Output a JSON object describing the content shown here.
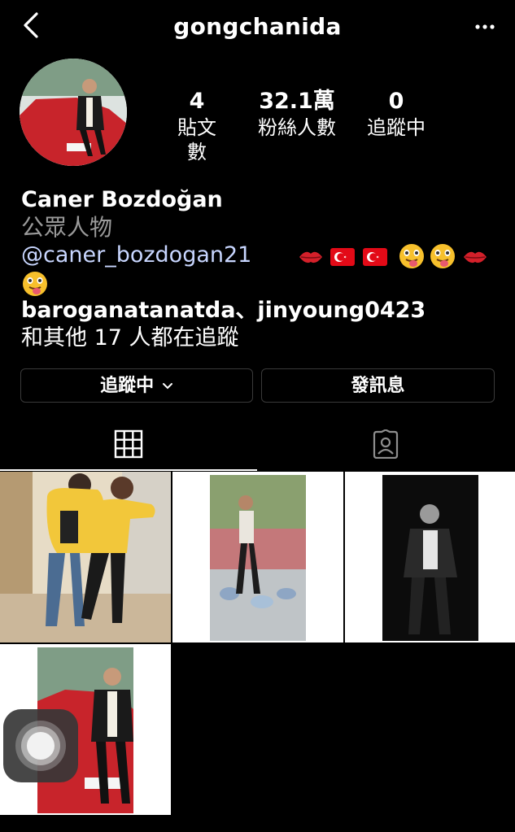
{
  "header": {
    "username": "gongchanida"
  },
  "stats": [
    {
      "value": "4",
      "label": "貼文數"
    },
    {
      "value": "32.1萬",
      "label": "粉絲人數"
    },
    {
      "value": "0",
      "label": "追蹤中"
    }
  ],
  "bio": {
    "name": "Caner Bozdoğan",
    "category": "公眾人物",
    "mention": "@caner_bozdogan21",
    "emojis": [
      "kiss-mark",
      "turkey-flag",
      "turkey-flag",
      "winking-tongue",
      "winking-tongue",
      "kiss-mark",
      "winking-tongue"
    ],
    "followed_by_line1": "baroganatanatda、jinyoung0423",
    "followed_by_line2": "和其他 17 人都在追蹤"
  },
  "buttons": {
    "following": "追蹤中",
    "message": "發訊息"
  },
  "tabs": [
    "grid-icon",
    "tagged-icon"
  ],
  "colors": {
    "background": "#000000",
    "link": "#c8d6ff",
    "muted": "#9a9a9a",
    "accent_yellow": "#f2c73a",
    "car_red": "#c8242b"
  }
}
